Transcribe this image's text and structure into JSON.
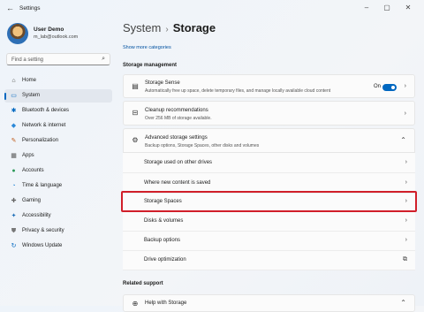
{
  "window": {
    "title": "Settings",
    "back_icon": "back-arrow-icon",
    "controls": [
      "minimize-icon",
      "maximize-icon",
      "close-icon"
    ]
  },
  "user": {
    "name": "User Demo",
    "email": "m_lab@outlook.com"
  },
  "search": {
    "placeholder": "Find a setting"
  },
  "nav": [
    {
      "label": "Home",
      "icon": "home-icon",
      "glyph": "⌂",
      "color": "#444444",
      "active": false
    },
    {
      "label": "System",
      "icon": "system-icon",
      "glyph": "▭",
      "color": "#0067c0",
      "active": true
    },
    {
      "label": "Bluetooth & devices",
      "icon": "bluetooth-icon",
      "glyph": "✱",
      "color": "#0067c0",
      "active": false
    },
    {
      "label": "Network & internet",
      "icon": "network-icon",
      "glyph": "◆",
      "color": "#2b88d8",
      "active": false
    },
    {
      "label": "Personalization",
      "icon": "personalization-icon",
      "glyph": "✎",
      "color": "#c05a1a",
      "active": false
    },
    {
      "label": "Apps",
      "icon": "apps-icon",
      "glyph": "▦",
      "color": "#555555",
      "active": false
    },
    {
      "label": "Accounts",
      "icon": "accounts-icon",
      "glyph": "●",
      "color": "#2e9a5a",
      "active": false
    },
    {
      "label": "Time & language",
      "icon": "time-language-icon",
      "glyph": "◔",
      "color": "#2b88d8",
      "active": false
    },
    {
      "label": "Gaming",
      "icon": "gaming-icon",
      "glyph": "✚",
      "color": "#666666",
      "active": false
    },
    {
      "label": "Accessibility",
      "icon": "accessibility-icon",
      "glyph": "✦",
      "color": "#1f6fb8",
      "active": false
    },
    {
      "label": "Privacy & security",
      "icon": "shield-icon",
      "glyph": "⛊",
      "color": "#777777",
      "active": false
    },
    {
      "label": "Windows Update",
      "icon": "windows-update-icon",
      "glyph": "↻",
      "color": "#0067c0",
      "active": false
    }
  ],
  "breadcrumb": {
    "parent": "System",
    "separator": "›",
    "current": "Storage"
  },
  "show_more": "Show more categories",
  "storage_management": {
    "title": "Storage management",
    "storage_sense": {
      "title": "Storage Sense",
      "subtitle": "Automatically free up space, delete temporary files, and manage locally available cloud content",
      "toggle_label": "On",
      "toggle_on": true,
      "icon": "storage-sense-icon"
    },
    "cleanup": {
      "title": "Cleanup recommendations",
      "subtitle": "Over 256 MB of storage available.",
      "icon": "cleanup-icon"
    },
    "advanced": {
      "title": "Advanced storage settings",
      "subtitle": "Backup options, Storage Spaces, other disks and volumes",
      "icon": "gear-icon",
      "expanded": true,
      "items": [
        {
          "label": "Storage used on other drives",
          "chevron": "›"
        },
        {
          "label": "Where new content is saved",
          "chevron": "›"
        },
        {
          "label": "Storage Spaces",
          "chevron": "›"
        },
        {
          "label": "Disks & volumes",
          "chevron": "›"
        },
        {
          "label": "Backup options",
          "chevron": "›"
        },
        {
          "label": "Drive optimization",
          "chevron": "⧉"
        }
      ]
    }
  },
  "related": {
    "title": "Related support",
    "help": {
      "title": "Help with Storage",
      "icon": "globe-icon"
    }
  },
  "accent_color": "#0067c0",
  "highlight_color": "#d11f2a"
}
